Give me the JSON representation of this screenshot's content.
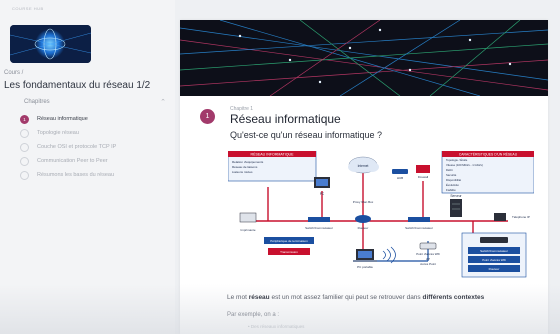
{
  "app": {
    "topbar_text": "COURSE HUB"
  },
  "sidebar": {
    "breadcrumb": "Cours /",
    "course_title": "Les fondamentaux du réseau 1/2",
    "chapters_label": "Chapitres",
    "items": [
      {
        "num": "1",
        "label": "Réseau informatique",
        "active": true
      },
      {
        "num": "2",
        "label": "Topologie réseau",
        "active": false
      },
      {
        "num": "3",
        "label": "Couche OSI et protocole TCP IP",
        "active": false
      },
      {
        "num": "4",
        "label": "Communication Peer to Peer",
        "active": false
      },
      {
        "num": "5",
        "label": "Résumons les bases du réseau",
        "active": false
      }
    ]
  },
  "section": {
    "number": "1",
    "sup": "Chapitre 1",
    "title": "Réseau informatique",
    "question": "Qu'est-ce qu'un réseau informatique ?"
  },
  "diagram": {
    "left_box_title": "RÉSEAU INFORMATIQUE",
    "left_box_lines": [
      "Relation d'équipements",
      "Réseau de liaisons",
      "Liaisons mixtes"
    ],
    "right_box_title": "CARACTÉRISTIQUES D'UN RÉSEAU",
    "right_box_lines": [
      "Topologie / Étoile",
      "Vitesse (100 Mbit/s - 1 Gbit/s)",
      "Débit",
      "Sécurité",
      "Disponibilité",
      "Évolutivité",
      "Fiabilité"
    ],
    "labels": {
      "internet": "Internet",
      "firewall": "Firewall",
      "hub": "HUB",
      "pc": "PC",
      "proxy": "Proxy Wan Box",
      "serveur": "Serveur",
      "imprimante": "Imprimante",
      "switch1": "Switch/Commutateur",
      "routeur": "Routeur",
      "switch2": "Switch/Commutateur",
      "telephone": "Téléphone IP",
      "peripherique": "Périphérique de terminaison",
      "transmission": "Transmission",
      "pc_portable": "PC portable",
      "point_acces": "Point d'accès Wifi",
      "ap": "AP",
      "access_point": "Accès Point",
      "box1": "Switch/Commutateur",
      "box2": "Point d'accès Wifi",
      "box3": "Routeur"
    }
  },
  "paragraph": {
    "p1_before": "Le mot ",
    "p1_bold1": "réseau",
    "p1_middle": " est un mot assez familier qui peut se retrouver dans ",
    "p1_bold2": "différents contextes",
    "p2": "Par exemple, on a :",
    "p3": "• Des réseaux informatiques"
  },
  "colors": {
    "accent": "#a23a6b",
    "diagram_red": "#c8102e",
    "diagram_blue": "#1b4fa0"
  }
}
